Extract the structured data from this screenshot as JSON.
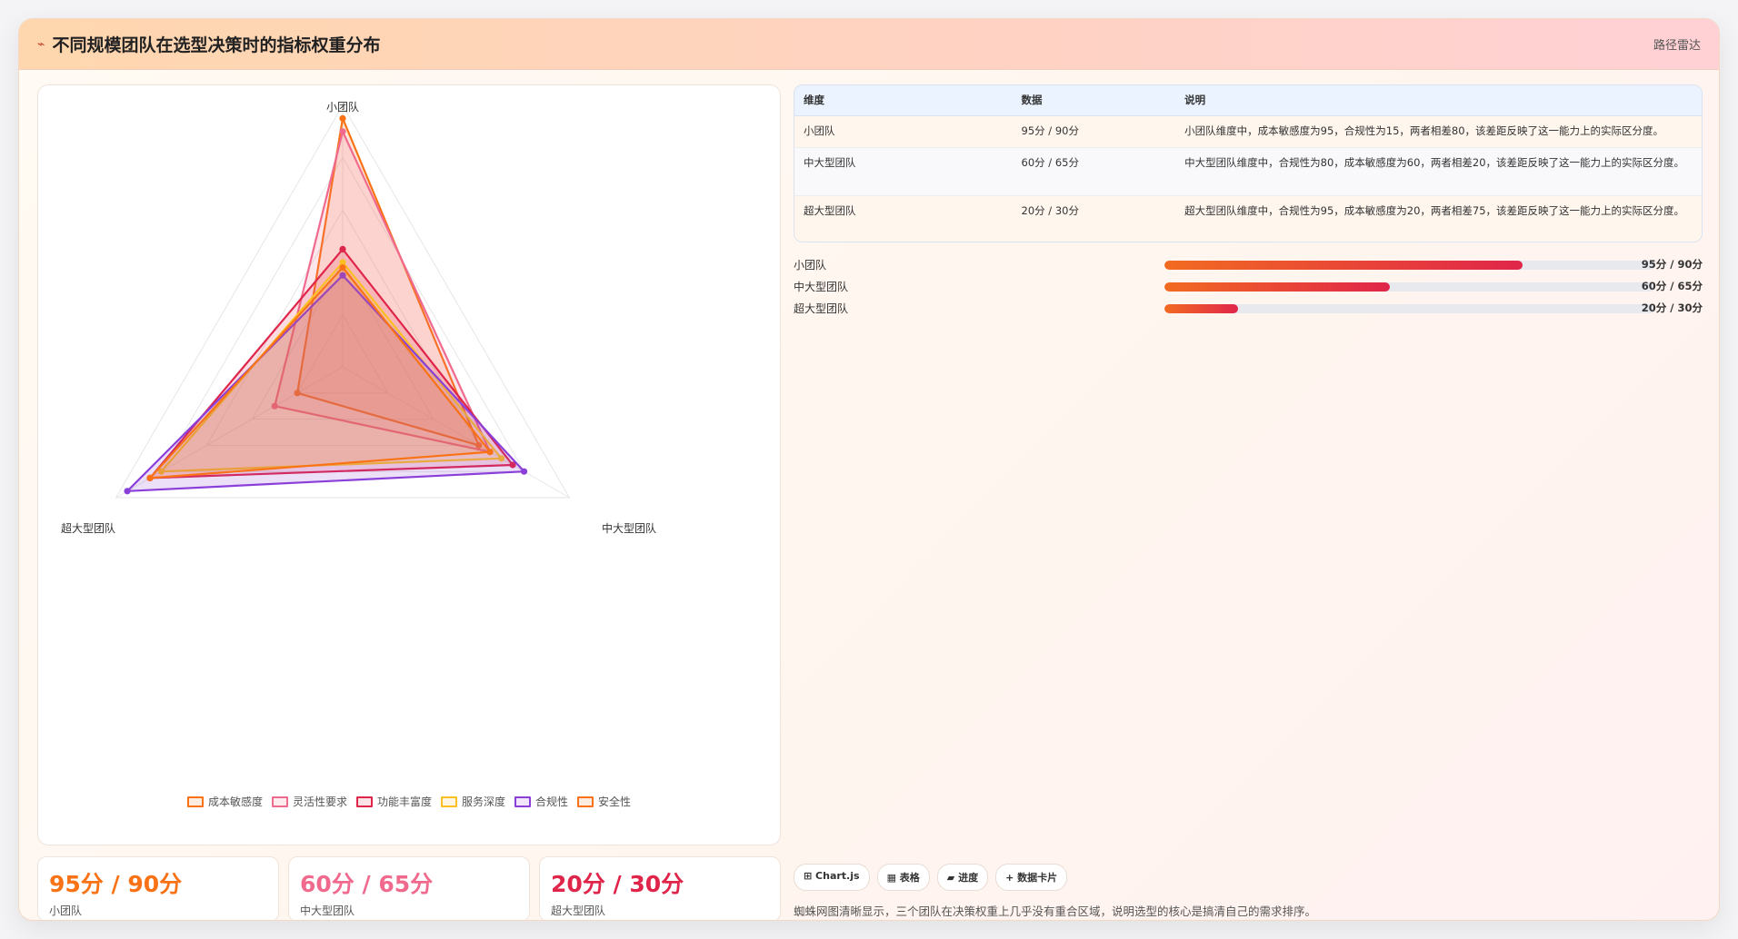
{
  "header": {
    "icon": "⌁",
    "title": "不同规模团队在选型决策时的指标权重分布",
    "tag": "路径雷达"
  },
  "colors": {
    "accent": "#f97316",
    "pink": "#f06a8e",
    "crimson": "#e0254a",
    "yellow": "#fbbf24",
    "purple": "#8b3fd9"
  },
  "chart_data": {
    "type": "radar",
    "axes": [
      "小团队",
      "中大型团队",
      "超大型团队"
    ],
    "range": [
      0,
      100
    ],
    "series": [
      {
        "name": "成本敏感度",
        "color": "#f97316",
        "values": [
          95,
          60,
          20
        ]
      },
      {
        "name": "灵活性要求",
        "color": "#f06a8e",
        "values": [
          90,
          65,
          30
        ]
      },
      {
        "name": "功能丰富度",
        "color": "#e0254a",
        "values": [
          45,
          75,
          85
        ]
      },
      {
        "name": "服务深度",
        "color": "#fbbf24",
        "values": [
          40,
          70,
          80
        ]
      },
      {
        "name": "合规性",
        "color": "#8b3fd9",
        "values": [
          35,
          80,
          95
        ]
      },
      {
        "name": "安全性",
        "color": "#f97316",
        "values": [
          38,
          65,
          85
        ]
      }
    ]
  },
  "stats": [
    {
      "value": "95分 / 90分",
      "label": "小团队",
      "color": "#f97316"
    },
    {
      "value": "60分 / 65分",
      "label": "中大型团队",
      "color": "#f06a8e"
    },
    {
      "value": "20分 / 30分",
      "label": "超大型团队",
      "color": "#e0254a"
    }
  ],
  "table": {
    "headers": [
      "维度",
      "数据",
      "说明"
    ],
    "rows": [
      [
        "小团队",
        "95分 / 90分",
        "小团队维度中，成本敏感度为95，合规性为15，两者相差80，该差距反映了这一能力上的实际区分度。"
      ],
      [
        "中大型团队",
        "60分 / 65分",
        "中大型团队维度中，合规性为80，成本敏感度为60，两者相差20，该差距反映了这一能力上的实际区分度。"
      ],
      [
        "超大型团队",
        "20分 / 30分",
        "超大型团队维度中，合规性为95，成本敏感度为20，两者相差75，该差距反映了这一能力上的实际区分度。"
      ]
    ]
  },
  "progress": [
    {
      "label": "小团队",
      "value": "95分 / 90分",
      "fill": 73
    },
    {
      "label": "中大型团队",
      "value": "60分 / 65分",
      "fill": 46
    },
    {
      "label": "超大型团队",
      "value": "20分 / 30分",
      "fill": 15
    }
  ],
  "chips": [
    "⊞ Chart.js",
    "▦ 表格",
    "▰ 进度",
    "+ 数据卡片"
  ],
  "note": "蜘蛛网图清晰显示，三个团队在决策权重上几乎没有重合区域，说明选型的核心是搞清自己的需求排序。"
}
